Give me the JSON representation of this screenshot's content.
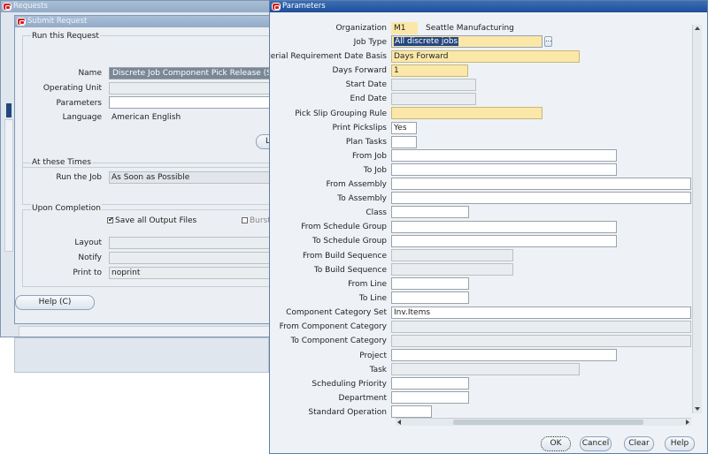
{
  "requests_window": {
    "title": "Requests"
  },
  "submit_window": {
    "title": "Submit Request",
    "run_section": {
      "title": "Run this Request",
      "name_label": "Name",
      "name_value": "Discrete Job Component Pick Release (SRS)",
      "operating_unit_label": "Operating Unit",
      "operating_unit_value": "",
      "parameters_label": "Parameters",
      "parameters_value": "",
      "language_label": "Language",
      "language_value": "American English",
      "partial_button": "L"
    },
    "times_section": {
      "title": "At these Times",
      "run_job_label": "Run the Job",
      "run_job_value": "As Soon as Possible"
    },
    "completion_section": {
      "title": "Upon Completion",
      "save_output_label": "Save all Output Files",
      "save_output_checked": true,
      "burst_label": "Burst",
      "burst_checked": false,
      "layout_label": "Layout",
      "layout_value": "",
      "notify_label": "Notify",
      "notify_value": "",
      "print_to_label": "Print to",
      "print_to_value": "noprint"
    },
    "help_button": "Help (C)"
  },
  "parameters_window": {
    "title": "Parameters",
    "fields": {
      "organization": {
        "label": "Organization",
        "code": "M1",
        "name": "Seattle Manufacturing"
      },
      "job_type": {
        "label": "Job Type",
        "value": "All discrete jobs"
      },
      "material_requirement_date_basis": {
        "label": "Material Requirement Date Basis",
        "value": "Days Forward"
      },
      "days_forward": {
        "label": "Days Forward",
        "value": "1"
      },
      "start_date": {
        "label": "Start Date",
        "value": ""
      },
      "end_date": {
        "label": "End Date",
        "value": ""
      },
      "pick_slip_grouping_rule": {
        "label": "Pick Slip Grouping Rule",
        "value": ""
      },
      "print_pickslips": {
        "label": "Print Pickslips",
        "value": "Yes"
      },
      "plan_tasks": {
        "label": "Plan Tasks",
        "value": ""
      },
      "from_job": {
        "label": "From Job",
        "value": ""
      },
      "to_job": {
        "label": "To Job",
        "value": ""
      },
      "from_assembly": {
        "label": "From Assembly",
        "value": ""
      },
      "to_assembly": {
        "label": "To Assembly",
        "value": ""
      },
      "class": {
        "label": "Class",
        "value": ""
      },
      "from_schedule_group": {
        "label": "From Schedule Group",
        "value": ""
      },
      "to_schedule_group": {
        "label": "To Schedule Group",
        "value": ""
      },
      "from_build_sequence": {
        "label": "From Build Sequence",
        "value": ""
      },
      "to_build_sequence": {
        "label": "To Build Sequence",
        "value": ""
      },
      "from_line": {
        "label": "From Line",
        "value": ""
      },
      "to_line": {
        "label": "To Line",
        "value": ""
      },
      "component_category_set": {
        "label": "Component Category Set",
        "value": "Inv.Items"
      },
      "from_component_category": {
        "label": "From Component Category",
        "value": ""
      },
      "to_component_category": {
        "label": "To Component Category",
        "value": ""
      },
      "project": {
        "label": "Project",
        "value": ""
      },
      "task": {
        "label": "Task",
        "value": ""
      },
      "scheduling_priority": {
        "label": "Scheduling Priority",
        "value": ""
      },
      "department": {
        "label": "Department",
        "value": ""
      },
      "standard_operation": {
        "label": "Standard Operation",
        "value": ""
      }
    },
    "lov_button": "...",
    "buttons": {
      "ok": "OK",
      "cancel": "Cancel",
      "clear": "Clear",
      "help": "Help"
    }
  }
}
